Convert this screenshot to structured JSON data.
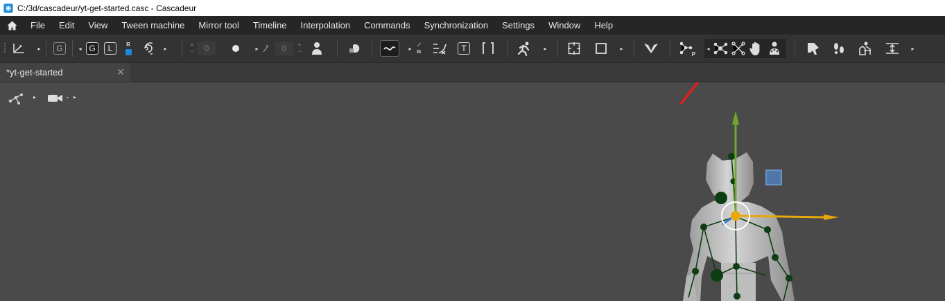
{
  "window": {
    "title": "C:/3d/cascadeur/yt-get-started.casc - Cascadeur"
  },
  "menu": {
    "items": [
      "File",
      "Edit",
      "View",
      "Tween machine",
      "Mirror tool",
      "Timeline",
      "Interpolation",
      "Commands",
      "Synchronization",
      "Settings",
      "Window",
      "Help"
    ]
  },
  "toolbar": {
    "global_label": "G",
    "global_local": [
      "G",
      "L"
    ],
    "rl_badge": "R",
    "field_a": "0",
    "field_b": "0",
    "text_tool": "T",
    "plus": "+",
    "minus": "−",
    "pin_label": "P",
    "icons": [
      "axes-icon",
      "joint-tool-icon",
      "point-controllers-icon",
      "fulcrum-icon",
      "hand-icon",
      "rig-icon",
      "pose-icon",
      "trajectory-icon",
      "frame-icon",
      "square-icon",
      "v-icon",
      "run-icon",
      "person-icon"
    ]
  },
  "tabs": [
    {
      "label": "*yt-get-started",
      "close": "✕"
    }
  ],
  "viewport": {
    "tool_icons": [
      "bones-icon",
      "camera-icon"
    ]
  },
  "colors": {
    "background": "#4a4a4a",
    "menubar": "#262626",
    "toolbar": "#333333",
    "joint": "#0d3d12",
    "axis_y": "#6fa82a",
    "axis_x": "#e8a70c",
    "annotation": "#e02020"
  }
}
